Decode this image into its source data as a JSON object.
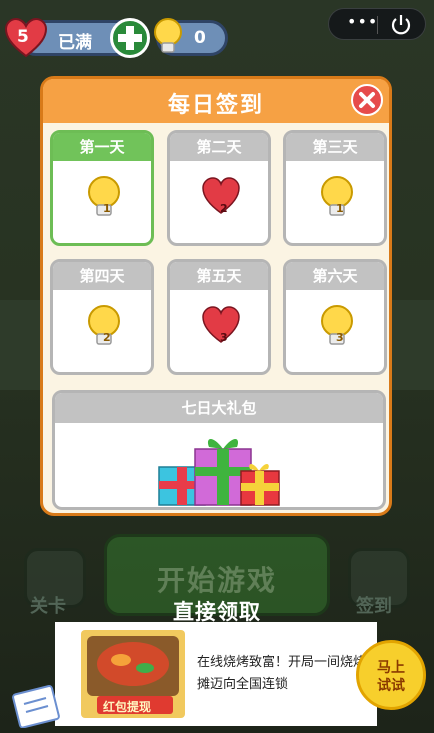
{
  "hud": {
    "hearts_count": "5",
    "hearts_status": "已满",
    "hints_count": "0"
  },
  "modal": {
    "title": "每日签到",
    "days": [
      {
        "label": "第一天",
        "reward": "bulb",
        "count": "1",
        "active": true
      },
      {
        "label": "第二天",
        "reward": "heart",
        "count": "2",
        "active": false
      },
      {
        "label": "第三天",
        "reward": "bulb",
        "count": "1",
        "active": false
      },
      {
        "label": "第四天",
        "reward": "bulb",
        "count": "2",
        "active": false
      },
      {
        "label": "第五天",
        "reward": "heart",
        "count": "3",
        "active": false
      },
      {
        "label": "第六天",
        "reward": "bulb",
        "count": "3",
        "active": false
      }
    ],
    "gift_label": "七日大礼包"
  },
  "game": {
    "start_label": "开始游戏",
    "levels_label": "关卡",
    "signin_label": "签到"
  },
  "claim_label": "直接领取",
  "ad": {
    "text": "在线烧烤致富！开局一间烧烤摊迈向全国连锁",
    "image_caption": "红包提现",
    "cta": [
      "马上",
      "试试"
    ]
  },
  "colors": {
    "header_orange": "#f6a144",
    "active_green": "#71c35a",
    "inactive_gray": "#c2c2c2",
    "close_red": "#e64b4b"
  }
}
